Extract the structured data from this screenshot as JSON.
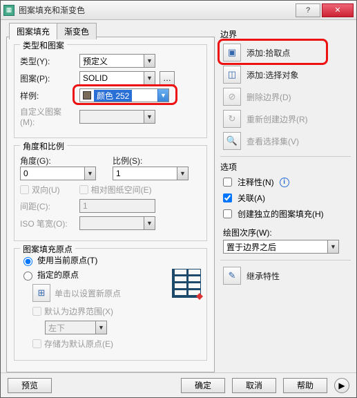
{
  "window": {
    "title": "图案填充和渐变色"
  },
  "tabs": {
    "hatch": "图案填充",
    "gradient": "渐变色"
  },
  "typePattern": {
    "legend": "类型和图案",
    "typeLabel": "类型(Y):",
    "typeValue": "预定义",
    "patternLabel": "图案(P):",
    "patternValue": "SOLID",
    "sampleLabel": "样例:",
    "colorValue": "颜色 252",
    "customLabel": "自定义图案(M):"
  },
  "angleScale": {
    "legend": "角度和比例",
    "angleLabel": "角度(G):",
    "angleValue": "0",
    "scaleLabel": "比例(S):",
    "scaleValue": "1",
    "bidir": "双向(U)",
    "relPaper": "相对图纸空间(E)",
    "spacingLabel": "间距(C):",
    "spacingValue": "1",
    "isoLabel": "ISO 笔宽(O):"
  },
  "origin": {
    "legend": "图案填充原点",
    "useCurrent": "使用当前原点(T)",
    "specified": "指定的原点",
    "clickNew": "单击以设置新原点",
    "defaultBoundary": "默认为边界范围(X)",
    "position": "左下",
    "storeDefault": "存储为默认原点(E)"
  },
  "boundary": {
    "title": "边界",
    "pickPoints": "添加:拾取点",
    "selectObjects": "添加:选择对象",
    "removeBoundary": "删除边界(D)",
    "recreateBoundary": "重新创建边界(R)",
    "viewSelection": "查看选择集(V)"
  },
  "options": {
    "title": "选项",
    "annotative": "注释性(N)",
    "associative": "关联(A)",
    "independent": "创建独立的图案填充(H)",
    "drawOrderLabel": "绘图次序(W):",
    "drawOrderValue": "置于边界之后",
    "inherit": "继承特性"
  },
  "footer": {
    "preview": "预览",
    "ok": "确定",
    "cancel": "取消",
    "help": "帮助"
  }
}
